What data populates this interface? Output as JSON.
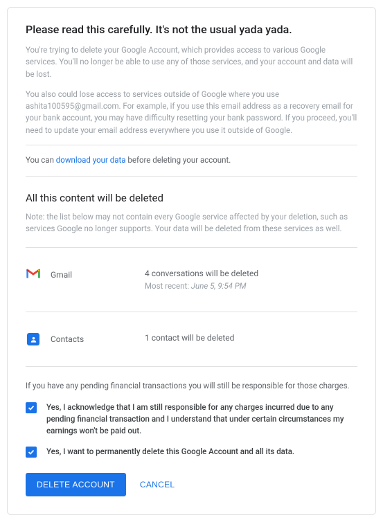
{
  "header": {
    "title": "Please read this carefully. It's not the usual yada yada."
  },
  "intro": {
    "p1": "You're trying to delete your Google Account, which provides access to various Google services. You'll no longer be able to use any of those services, and your account and data will be lost.",
    "p2": "You also could lose access to services outside of Google where you use ashita100595@gmail.com. For example, if you use this email address as a recovery email for your bank account, you may have difficulty resetting your bank password. If you proceed, you'll need to update your email address everywhere you use it outside of Google."
  },
  "download": {
    "prefix": "You can ",
    "link": "download your data",
    "suffix": " before deleting your account."
  },
  "content_section": {
    "heading": "All this content will be deleted",
    "note": "Note: the list below may not contain every Google service affected by your deletion, such as services Google no longer supports. Your data will be deleted from these services as well."
  },
  "services": {
    "gmail": {
      "name": "Gmail",
      "summary": "4 conversations will be deleted",
      "recent_label": "Most recent: ",
      "recent_value": "June 5, 9:54 PM"
    },
    "contacts": {
      "name": "Contacts",
      "summary": "1 contact will be deleted"
    }
  },
  "financial_notice": "If you have any pending financial transactions you will still be responsible for those charges.",
  "checks": {
    "ack1": "Yes, I acknowledge that I am still responsible for any charges incurred due to any pending financial transaction and I understand that under certain circumstances my earnings won't be paid out.",
    "ack2": "Yes, I want to permanently delete this Google Account and all its data."
  },
  "actions": {
    "delete": "DELETE ACCOUNT",
    "cancel": "CANCEL"
  }
}
